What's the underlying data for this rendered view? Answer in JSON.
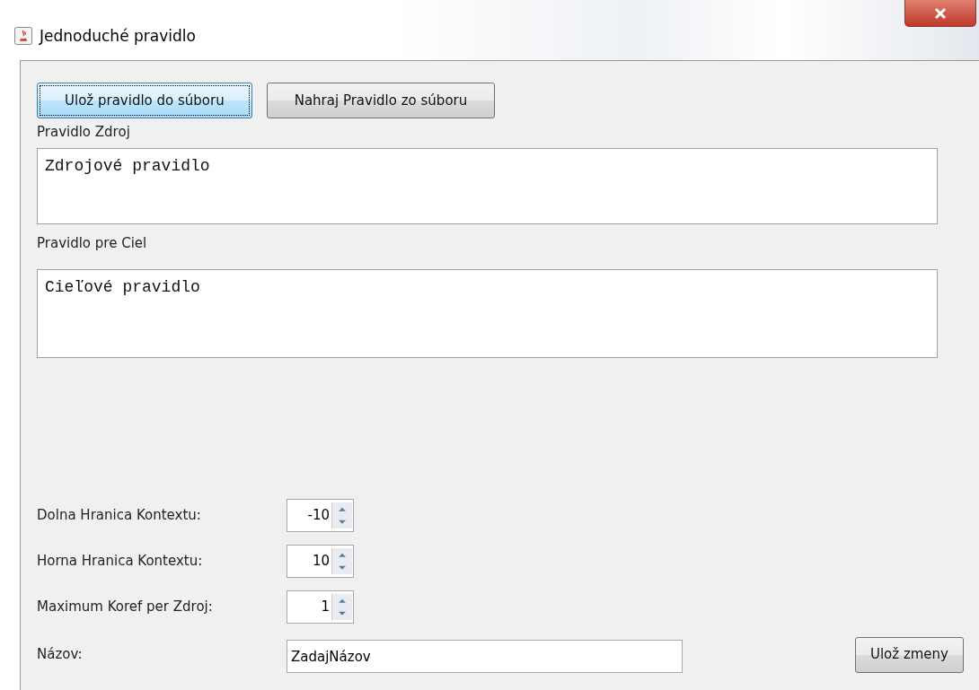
{
  "window": {
    "title": "Jednoduché pravidlo"
  },
  "file_buttons": [
    {
      "label": "Ulož pravidlo do súboru",
      "focused": true
    },
    {
      "label": "Nahraj Pravidlo zo súboru",
      "focused": false
    }
  ],
  "source": {
    "label": "Pravidlo Zdroj",
    "value": "Zdrojové pravidlo"
  },
  "target": {
    "label": "Pravidlo pre Ciel",
    "value": "Cieľové pravidlo"
  },
  "spinners": [
    {
      "label": "Dolna Hranica Kontextu:",
      "value": "-10"
    },
    {
      "label": "Horna Hranica Kontextu:",
      "value": "10"
    },
    {
      "label": "Maximum Koref per Zdroj:",
      "value": "1"
    }
  ],
  "name": {
    "label": "Názov:",
    "value": "ZadajNázov"
  },
  "save_button": {
    "label": "Ulož zmeny"
  }
}
